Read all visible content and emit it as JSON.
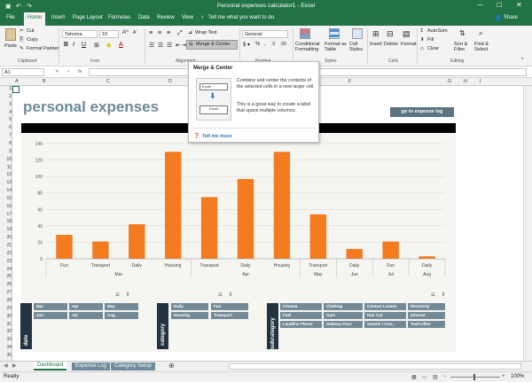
{
  "window": {
    "title": "Personal expenses calculator1 - Excel",
    "share": "Share"
  },
  "tabs": [
    "File",
    "Home",
    "Insert",
    "Page Layout",
    "Formulas",
    "Data",
    "Review",
    "View"
  ],
  "tell_me": "Tell me what you want to do",
  "ribbon": {
    "paste": "Paste",
    "cut": "Cut",
    "copy": "Copy",
    "format_painter": "Format Painter",
    "font_name": "Tahoma",
    "font_size": "10",
    "wrap_text": "Wrap Text",
    "merge_center": "Merge & Center",
    "number_format": "General",
    "cond_format": "Conditional Formatting",
    "format_table": "Format as Table",
    "cell_styles": "Cell Styles",
    "insert": "Insert",
    "delete": "Delete",
    "format": "Format",
    "autosum": "AutoSum",
    "fill": "Fill",
    "clear": "Clear",
    "sort_filter": "Sort & Filter",
    "find_select": "Find & Select",
    "groups": {
      "clipboard": "Clipboard",
      "font": "Font",
      "alignment": "Alignment",
      "number": "Number",
      "styles": "Styles",
      "cells": "Cells",
      "editing": "Editing"
    }
  },
  "formula_bar": {
    "name_box": "A1",
    "fx": "fx"
  },
  "tooltip": {
    "title": "Merge & Center",
    "body1": "Combine and center the contents of the selected cells in a new larger cell.",
    "body2": "This is a great way to create a label that spans multiple columns.",
    "tell_more": "Tell me more",
    "img_label1": "Excel",
    "img_label2": "Excel"
  },
  "columns": [
    "A",
    "B",
    "C",
    "D",
    "E",
    "F",
    "G",
    "H",
    "I"
  ],
  "rows": [
    "1",
    "2",
    "3",
    "4",
    "5",
    "6",
    "7",
    "8",
    "9",
    "10",
    "11",
    "12",
    "13",
    "14",
    "15",
    "16",
    "17",
    "18",
    "19",
    "20",
    "21",
    "22",
    "23",
    "24",
    "25",
    "26",
    "27",
    "28",
    "29",
    "30",
    "31",
    "32",
    "33",
    "34",
    "35"
  ],
  "sheet": {
    "heading": "personal expenses",
    "goto_button": "go to expense log"
  },
  "chart_data": {
    "type": "bar",
    "categories": [
      "Fun",
      "Transport",
      "Daily",
      "Housing",
      "Transport",
      "Daily",
      "Housing",
      "Transport",
      "Daily",
      "Fun",
      "Daily"
    ],
    "groups": [
      "Mar",
      "",
      "",
      "",
      "Apr",
      "",
      "",
      "May",
      "Jun",
      "Jul",
      "Aug"
    ],
    "values": [
      29,
      21,
      42,
      130,
      75,
      97,
      130,
      54,
      12,
      21,
      3
    ],
    "ylim": [
      0,
      140
    ],
    "yticks": [
      0,
      20,
      40,
      60,
      80,
      100,
      120,
      140
    ],
    "bar_color": "#f47b20",
    "grid": true
  },
  "slicers": [
    {
      "title": "date",
      "items": [
        "Mar",
        "Apr",
        "May",
        "Jun",
        "Jul",
        "Aug"
      ]
    },
    {
      "title": "category",
      "items": [
        "Daily",
        "Fun",
        "Housing",
        "Transport"
      ]
    },
    {
      "title": "subcategory",
      "items": [
        "Cinema",
        "Clothing",
        "Contact Lenses",
        "Electricity",
        "Fuel",
        "Gym",
        "Hair Cut",
        "Internet",
        "Landline Phone",
        "Subway Pass",
        "Sweets / Con...",
        "Tea/Coffee"
      ]
    }
  ],
  "sheet_tabs": [
    "Dashboard",
    "Expense Log",
    "Category Setup"
  ],
  "status": {
    "left": "Ready",
    "zoom": "100%"
  }
}
